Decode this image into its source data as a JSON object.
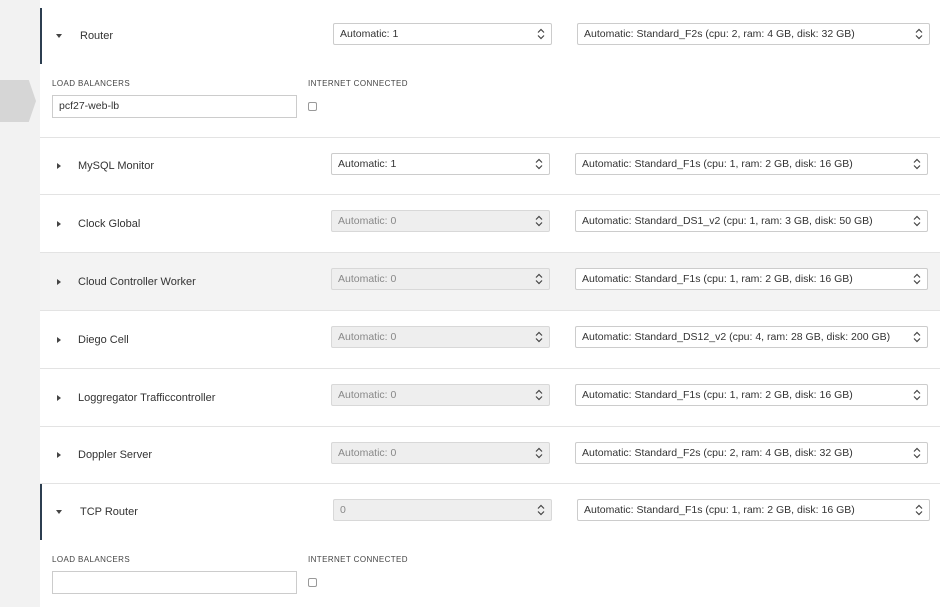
{
  "labels": {
    "load_balancers": "LOAD BALANCERS",
    "internet_connected": "INTERNET CONNECTED"
  },
  "jobs": [
    {
      "name": "Router",
      "expanded": true,
      "instances": "Automatic: 1",
      "instances_disabled": false,
      "vm_type": "Automatic: Standard_F2s (cpu: 2, ram: 4 GB, disk: 32 GB)",
      "load_balancers": "pcf27-web-lb",
      "internet_connected": false
    },
    {
      "name": "MySQL Monitor",
      "expanded": false,
      "instances": "Automatic: 1",
      "instances_disabled": false,
      "vm_type": "Automatic: Standard_F1s (cpu: 1, ram: 2 GB, disk: 16 GB)"
    },
    {
      "name": "Clock Global",
      "expanded": false,
      "instances": "Automatic: 0",
      "instances_disabled": true,
      "vm_type": "Automatic: Standard_DS1_v2 (cpu: 1, ram: 3 GB, disk: 50 GB)"
    },
    {
      "name": "Cloud Controller Worker",
      "expanded": false,
      "instances": "Automatic: 0",
      "instances_disabled": true,
      "vm_type": "Automatic: Standard_F1s (cpu: 1, ram: 2 GB, disk: 16 GB)"
    },
    {
      "name": "Diego Cell",
      "expanded": false,
      "instances": "Automatic: 0",
      "instances_disabled": true,
      "vm_type": "Automatic: Standard_DS12_v2 (cpu: 4, ram: 28 GB, disk: 200 GB)"
    },
    {
      "name": "Loggregator Trafficcontroller",
      "expanded": false,
      "instances": "Automatic: 0",
      "instances_disabled": true,
      "vm_type": "Automatic: Standard_F1s (cpu: 1, ram: 2 GB, disk: 16 GB)"
    },
    {
      "name": "Doppler Server",
      "expanded": false,
      "instances": "Automatic: 0",
      "instances_disabled": true,
      "vm_type": "Automatic: Standard_F2s (cpu: 2, ram: 4 GB, disk: 32 GB)"
    },
    {
      "name": "TCP Router",
      "expanded": true,
      "instances": "0",
      "instances_disabled": true,
      "vm_type": "Automatic: Standard_F1s (cpu: 1, ram: 2 GB, disk: 16 GB)",
      "load_balancers": "",
      "internet_connected": false
    }
  ]
}
